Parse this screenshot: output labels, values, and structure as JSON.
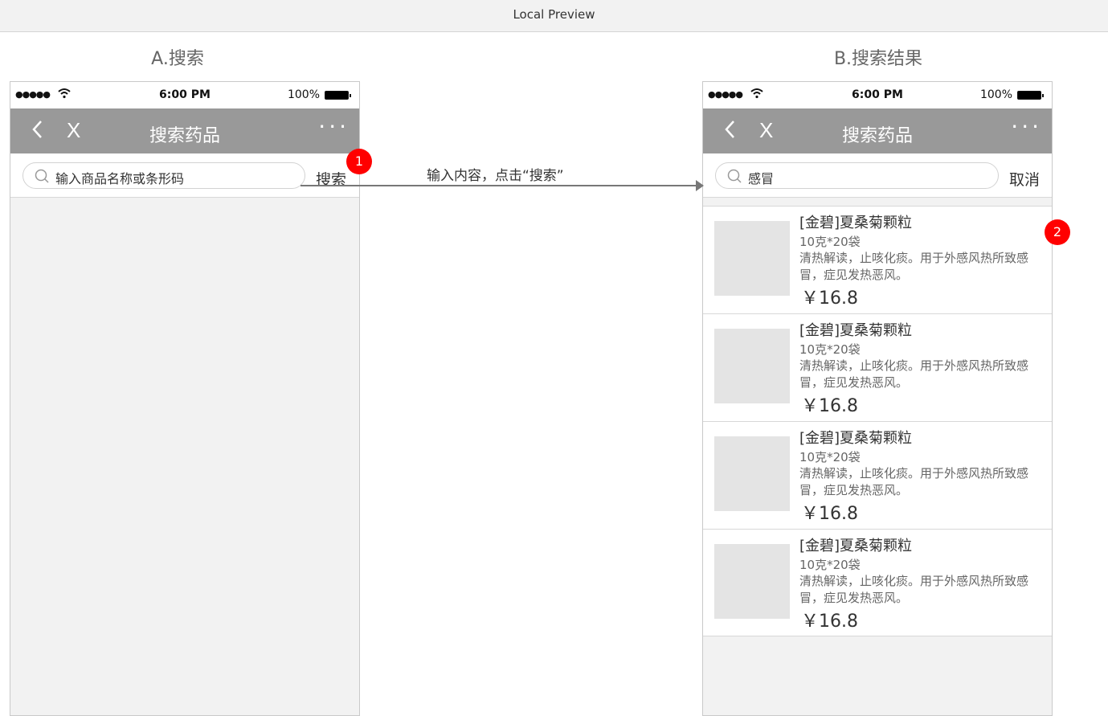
{
  "window": {
    "title": "Local Preview"
  },
  "frames": {
    "a_title": "A.搜索",
    "b_title": "B.搜索结果"
  },
  "status_bar": {
    "signal": "●●●●●",
    "time": "6:00 PM",
    "battery": "100%"
  },
  "navbar": {
    "back_icon": "chevron-left-icon",
    "close_label": "X",
    "title": "搜索药品",
    "more_label": "···"
  },
  "screen_a": {
    "search_placeholder": "输入商品名称或条形码",
    "search_button": "搜索"
  },
  "screen_b": {
    "search_value": "感冒",
    "cancel_button": "取消",
    "results": [
      {
        "name": "[金碧]夏桑菊颗粒",
        "spec": "10克*20袋",
        "desc": "清热解读，止咳化痰。用于外感风热所致感冒，症见发热恶风。",
        "price": "￥16.8"
      },
      {
        "name": "[金碧]夏桑菊颗粒",
        "spec": "10克*20袋",
        "desc": "清热解读，止咳化痰。用于外感风热所致感冒，症见发热恶风。",
        "price": "￥16.8"
      },
      {
        "name": "[金碧]夏桑菊颗粒",
        "spec": "10克*20袋",
        "desc": "清热解读，止咳化痰。用于外感风热所致感冒，症见发热恶风。",
        "price": "￥16.8"
      },
      {
        "name": "[金碧]夏桑菊颗粒",
        "spec": "10克*20袋",
        "desc": "清热解读，止咳化痰。用于外感风热所致感冒，症见发热恶风。",
        "price": "￥16.8"
      }
    ]
  },
  "annotations": {
    "badge_1": "1",
    "badge_2": "2",
    "flow_label": "输入内容，点击“搜索”"
  },
  "colors": {
    "navbar": "#999999",
    "badge": "#ff0000",
    "thumb": "#e4e4e4"
  }
}
